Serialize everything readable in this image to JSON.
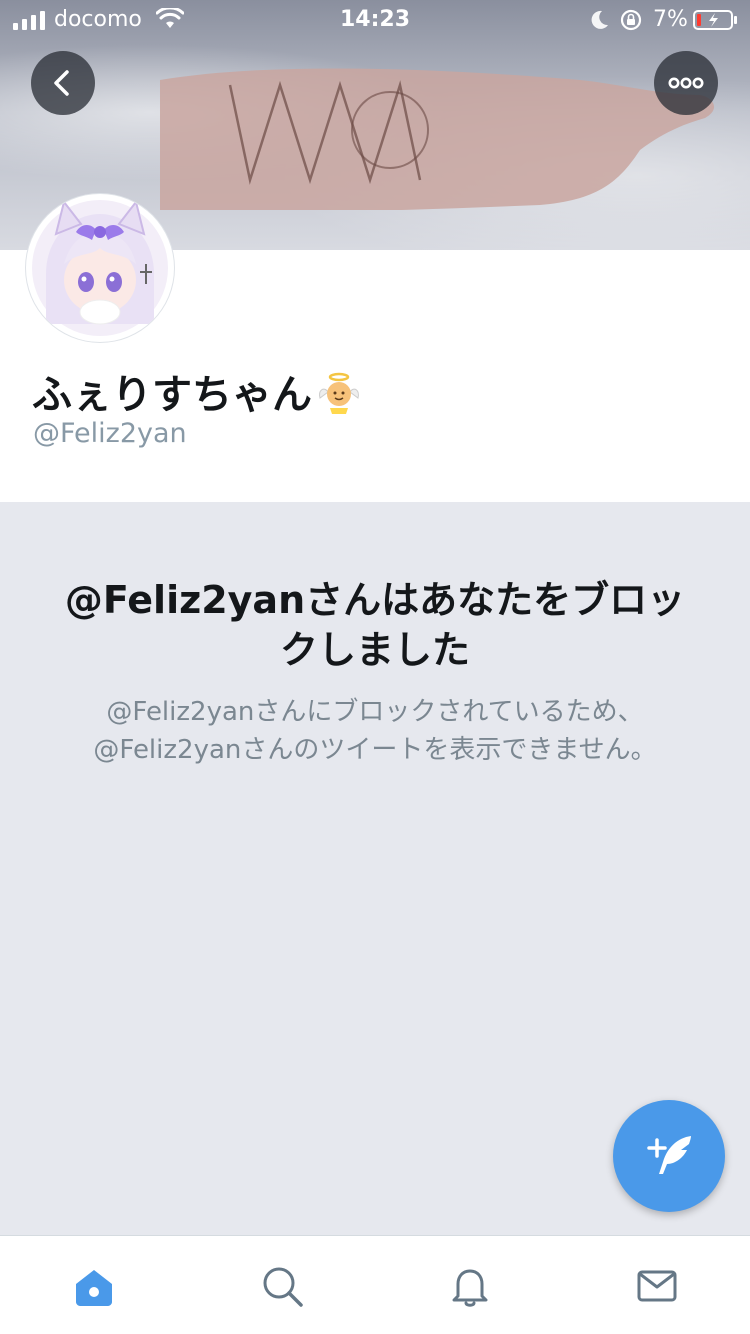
{
  "status_bar": {
    "carrier": "docomo",
    "time": "14:23",
    "battery_percent": "7%"
  },
  "profile": {
    "display_name": "ふぇりすちゃん",
    "handle": "@Feliz2yan",
    "name_emoji": "angel-baby-emoji"
  },
  "blocked": {
    "title": "@Feliz2yanさんはあなたをブロックしました",
    "description": "@Feliz2yanさんにブロックされているため、@Feliz2yanさんのツイートを表示できません。"
  },
  "icons": {
    "back": "chevron-left-icon",
    "more": "more-horizontal-icon",
    "compose": "compose-tweet-icon",
    "tabs": [
      "home-icon",
      "search-icon",
      "notifications-icon",
      "messages-icon"
    ]
  },
  "colors": {
    "accent": "#4a99e9",
    "blocked_background": "#e6e8ee",
    "secondary_text": "#8899a6"
  }
}
